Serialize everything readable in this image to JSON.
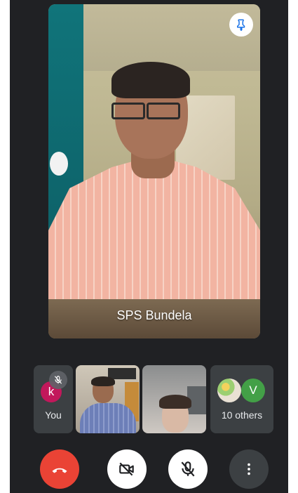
{
  "main_tile": {
    "participant_name": "SPS Bundela",
    "pinned": true
  },
  "thumbnails": {
    "you": {
      "avatar_letter": "k",
      "label": "You",
      "muted": true,
      "avatar_color": "#c2185b"
    },
    "others": {
      "avatar_letter": "V",
      "label": "10 others",
      "avatar_color": "#43a047"
    }
  },
  "controls": {
    "end_call": {
      "icon": "phone-hangup-icon",
      "color": "#ea4335"
    },
    "camera": {
      "icon": "camera-off-icon"
    },
    "microphone": {
      "icon": "mic-off-icon"
    },
    "more": {
      "icon": "more-vert-icon"
    }
  }
}
